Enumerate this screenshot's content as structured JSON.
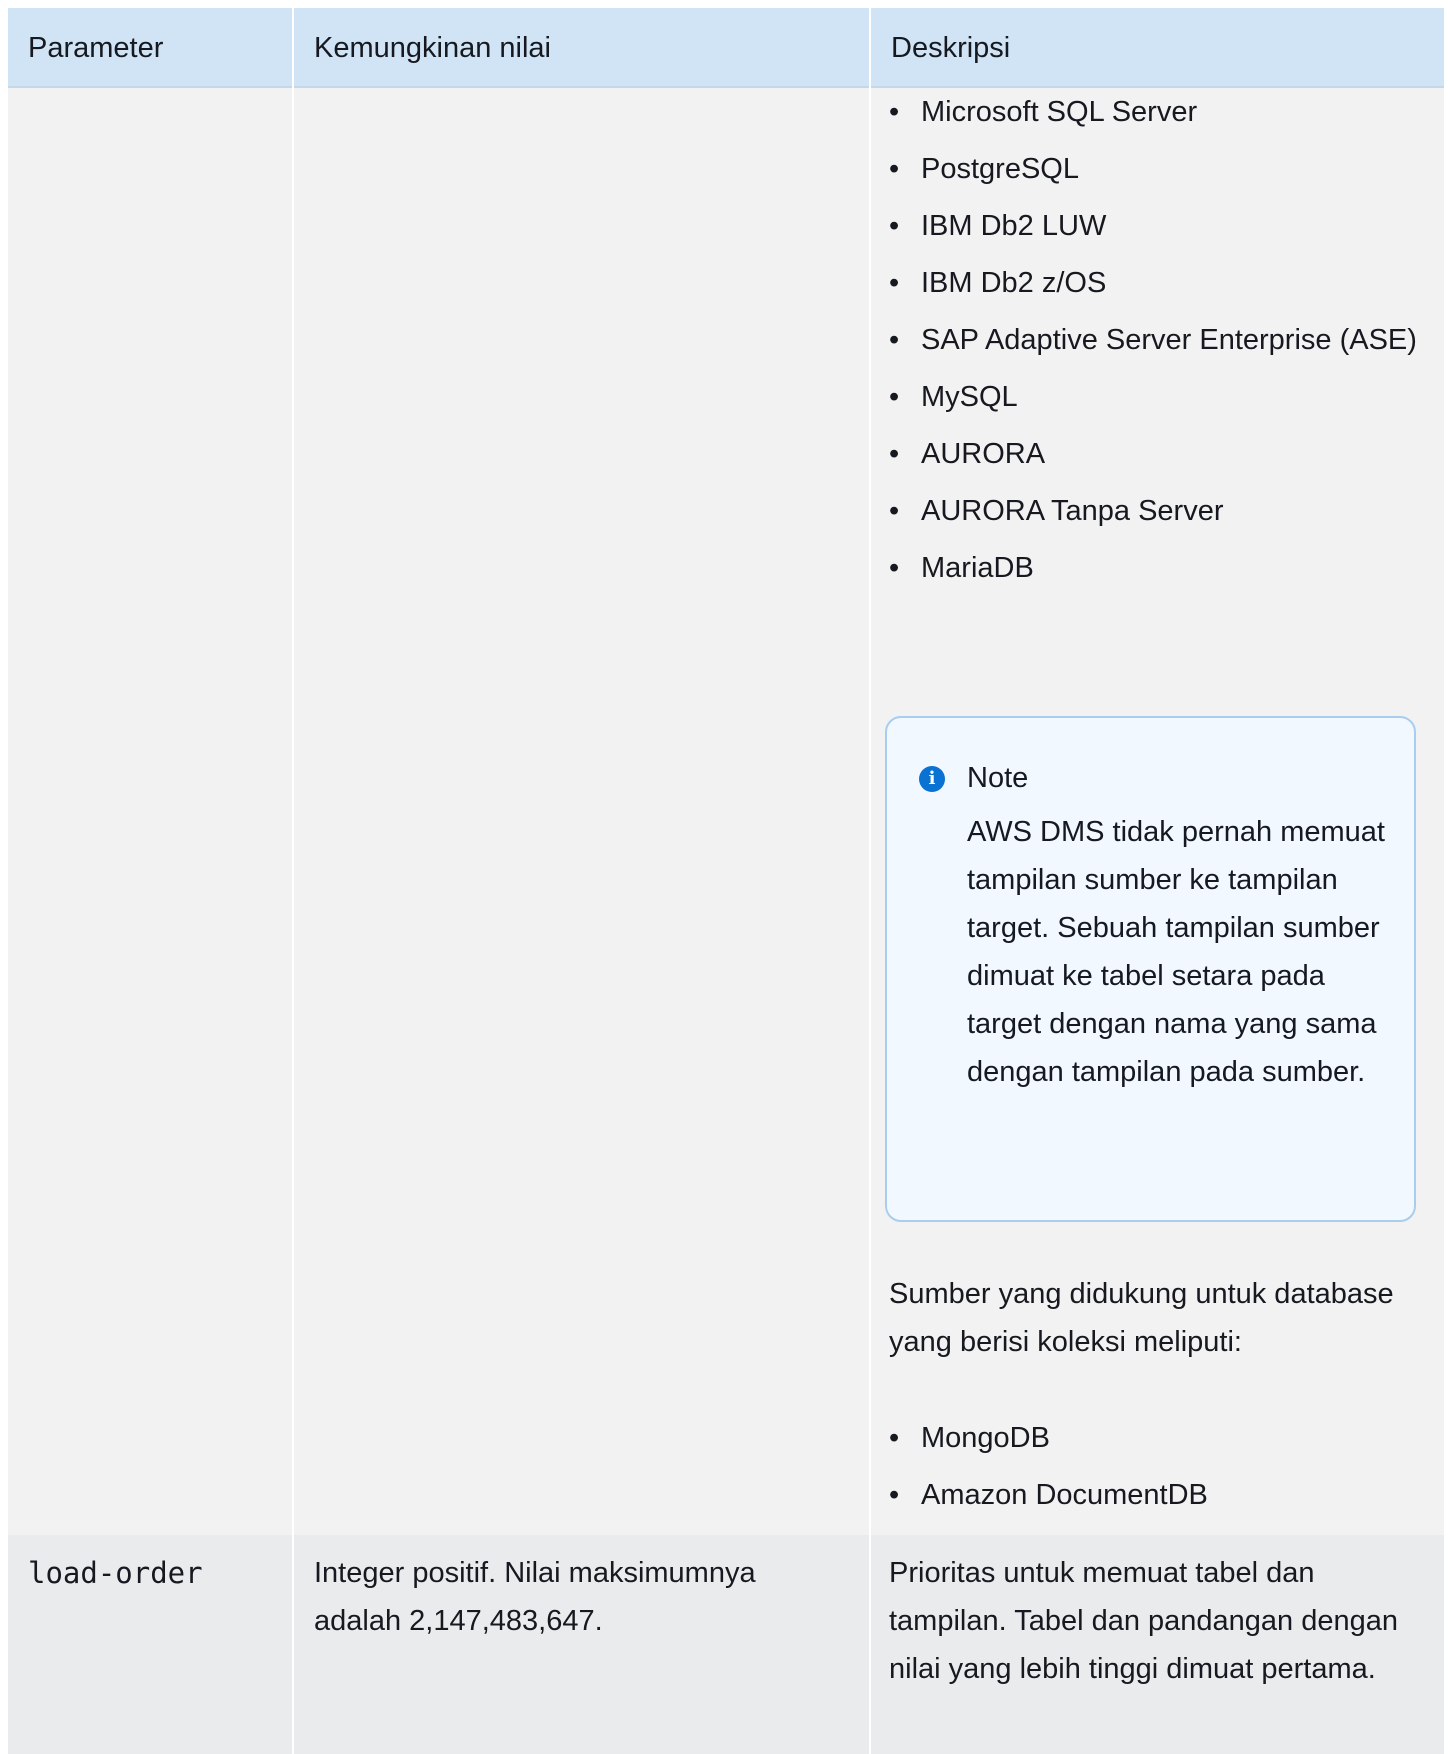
{
  "table": {
    "headers": {
      "parameter": "Parameter",
      "possible_values": "Kemungkinan nilai",
      "description": "Deskripsi"
    },
    "row1": {
      "source_list": [
        "Microsoft SQL Server",
        "PostgreSQL",
        "IBM Db2 LUW",
        "IBM Db2 z/OS",
        "SAP Adaptive Server Enterprise (ASE)",
        "MySQL",
        "AURORA",
        "AURORA Tanpa Server",
        "MariaDB"
      ],
      "note": {
        "title": "Note",
        "body": "AWS DMS tidak pernah memuat tampilan sumber ke tampilan target. Sebuah tampilan sumber dimuat ke tabel setara pada target dengan nama yang sama dengan tampilan pada sumber."
      },
      "collections_intro": "Sumber yang didukung untuk database yang berisi koleksi meliputi:",
      "collections_list": [
        "MongoDB",
        "Amazon DocumentDB"
      ]
    },
    "row2": {
      "parameter": "load-order",
      "possible_values": "Integer positif. Nilai maksimumnya adalah 2,147,483,647.",
      "description": "Prioritas untuk memuat tabel dan tampilan. Tabel dan pandangan dengan nilai yang lebih tinggi dimuat pertama."
    }
  },
  "colors": {
    "header_bg": "#d1e4f6",
    "row_bg": "#f2f2f2",
    "row_alt_bg": "#e9ebed",
    "note_bg": "#f1f8ff",
    "note_border": "#a8cdee",
    "info_icon": "#0972d3"
  },
  "icons": {
    "note": "info-icon"
  }
}
